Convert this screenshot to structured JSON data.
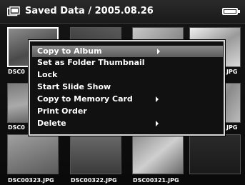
{
  "header": {
    "title": "Saved Data / 2005.08.26",
    "folder_icon": "folder-icon",
    "battery_icon": "battery-full-icon"
  },
  "thumbnails": [
    {
      "filename": "DSC0"
    },
    {
      "filename": ""
    },
    {
      "filename": ""
    },
    {
      "filename": ".JPG"
    },
    {
      "filename": "DSC0"
    },
    {
      "filename": ""
    },
    {
      "filename": ""
    },
    {
      "filename": ".JPG"
    },
    {
      "filename": "DSC00323.JPG"
    },
    {
      "filename": "DSC00322.JPG"
    },
    {
      "filename": "DSC00321.JPG"
    },
    {
      "filename": ""
    }
  ],
  "menu": {
    "items": [
      {
        "label": "Copy to Album",
        "submenu": true,
        "selected": true
      },
      {
        "label": "Set as Folder Thumbnail",
        "submenu": false,
        "selected": false
      },
      {
        "label": "Lock",
        "submenu": false,
        "selected": false
      },
      {
        "label": "Start Slide Show",
        "submenu": false,
        "selected": false
      },
      {
        "label": "Copy to Memory Card",
        "submenu": true,
        "selected": false
      },
      {
        "label": "Print Order",
        "submenu": false,
        "selected": false
      },
      {
        "label": "Delete",
        "submenu": true,
        "selected": false
      }
    ]
  }
}
